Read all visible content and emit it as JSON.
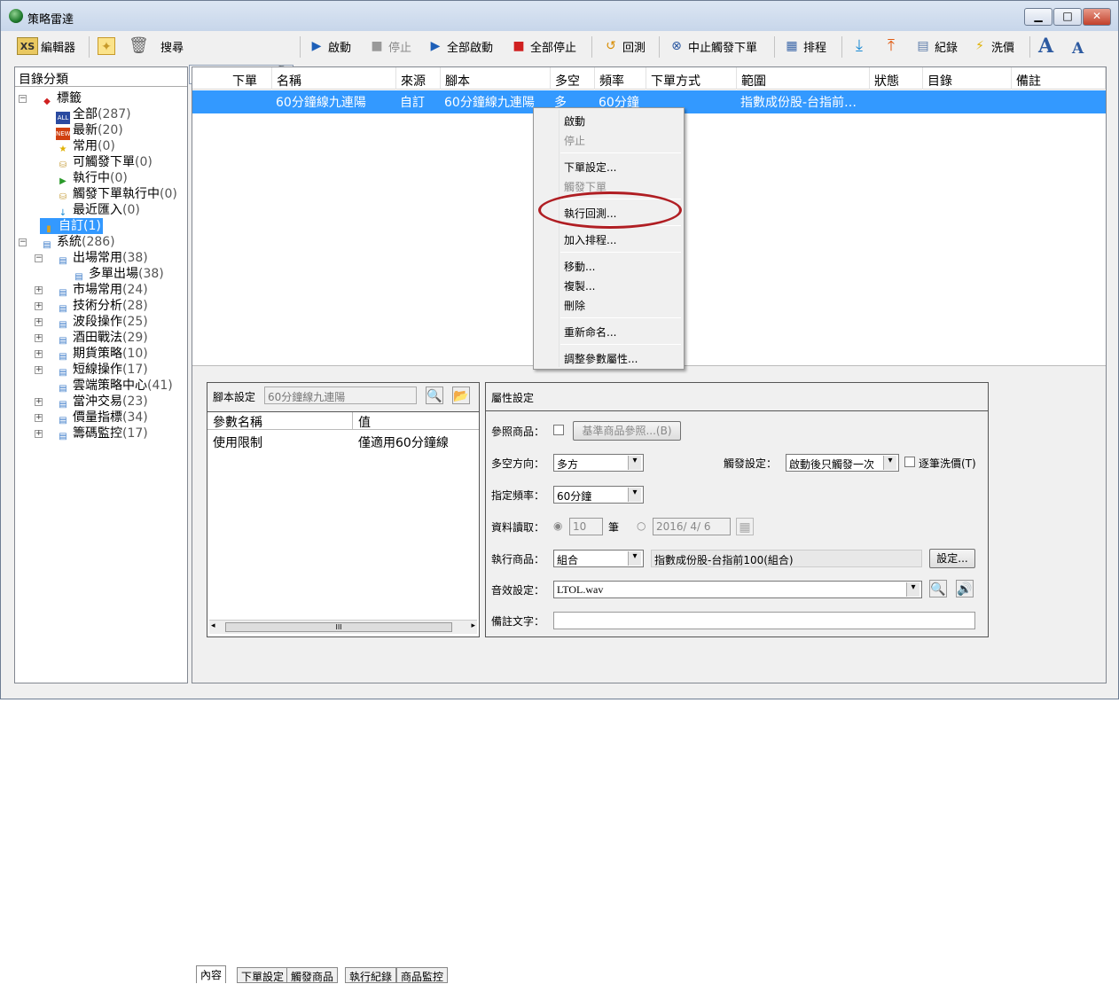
{
  "window": {
    "title": "策略雷達",
    "minimize": "▁",
    "maximize": "□",
    "close": "✕"
  },
  "toolbar": {
    "editor": {
      "icon_text": "XS",
      "label": "編輯器"
    },
    "search_label": "搜尋",
    "start": "啟動",
    "stop": "停止",
    "start_all": "全部啟動",
    "stop_all": "全部停止",
    "backtest": "回測",
    "stop_trigger": "中止觸發下單",
    "schedule": "排程",
    "log": "紀錄",
    "wash": "洗價",
    "font_up": "A",
    "font_down": "A"
  },
  "tree": {
    "header": "目錄分類",
    "items": [
      {
        "label": "標籤",
        "count": ""
      },
      {
        "label": "全部",
        "count": "(287)",
        "icon": "ALL"
      },
      {
        "label": "最新",
        "count": "(20)",
        "icon": "NEW"
      },
      {
        "label": "常用",
        "count": "(0)"
      },
      {
        "label": "可觸發下單",
        "count": "(0)"
      },
      {
        "label": "執行中",
        "count": "(0)"
      },
      {
        "label": "觸發下單執行中",
        "count": "(0)"
      },
      {
        "label": "最近匯入",
        "count": "(0)"
      },
      {
        "label": "自訂",
        "count": "(1)"
      },
      {
        "label": "系統",
        "count": "(286)"
      },
      {
        "label": "出場常用",
        "count": "(38)"
      },
      {
        "label": "多單出場",
        "count": "(38)"
      },
      {
        "label": "市場常用",
        "count": "(24)"
      },
      {
        "label": "技術分析",
        "count": "(28)"
      },
      {
        "label": "波段操作",
        "count": "(25)"
      },
      {
        "label": "酒田戰法",
        "count": "(29)"
      },
      {
        "label": "期貨策略",
        "count": "(10)"
      },
      {
        "label": "短線操作",
        "count": "(17)"
      },
      {
        "label": "雲端策略中心",
        "count": "(41)"
      },
      {
        "label": "當沖交易",
        "count": "(23)"
      },
      {
        "label": "價量指標",
        "count": "(34)"
      },
      {
        "label": "籌碼監控",
        "count": "(17)"
      }
    ]
  },
  "grid": {
    "columns": [
      "下單",
      "名稱",
      "來源",
      "腳本",
      "多空",
      "頻率",
      "下單方式",
      "範圍",
      "狀態",
      "目錄",
      "備註"
    ],
    "row": {
      "order": "",
      "name": "60分鐘線九連陽",
      "source": "自訂",
      "script": "60分鐘線九連陽",
      "direction": "多",
      "freq": "60分鐘",
      "order_type": "",
      "range": "指數成份股-台指前…",
      "status": "",
      "folder": "",
      "note": ""
    }
  },
  "context_menu": {
    "items": [
      "啟動",
      "停止",
      "下單設定...",
      "觸發下單",
      "執行回測...",
      "加入排程...",
      "移動...",
      "複製...",
      "刪除",
      "重新命名...",
      "調整參數屬性..."
    ]
  },
  "script_settings": {
    "label": "腳本設定",
    "name": "60分鐘線九連陽",
    "columns": [
      "參數名稱",
      "值"
    ],
    "rows": [
      {
        "name": "使用限制",
        "value": "僅適用60分鐘線"
      }
    ],
    "scroll_grip": "III"
  },
  "properties": {
    "title": "屬性設定",
    "ref_product_label": "參照商品：",
    "ref_product_button": "基準商品參照...(B)",
    "direction_label": "多空方向：",
    "direction_value": "多方",
    "trigger_label": "觸發設定：",
    "trigger_value": "啟動後只觸發一次",
    "wash_each": "逐筆洗價(T)",
    "freq_label": "指定頻率：",
    "freq_value": "60分鐘",
    "data_label": "資料讀取：",
    "data_count": "10",
    "data_unit": "筆",
    "data_date": "2016/ 4/ 6",
    "exec_label": "執行商品：",
    "exec_value": "組合",
    "exec_desc": "指數成份股-台指前100(組合)",
    "exec_button": "設定...",
    "sound_label": "音效設定：",
    "sound_value": "LTOL.wav",
    "note_label": "備註文字：",
    "note_value": ""
  },
  "tabs": [
    "內容",
    "下單設定",
    "觸發商品",
    "執行紀錄",
    "商品監控"
  ],
  "colors": {
    "selection": "#3399ff",
    "highlight_ring": "#b01e23"
  }
}
